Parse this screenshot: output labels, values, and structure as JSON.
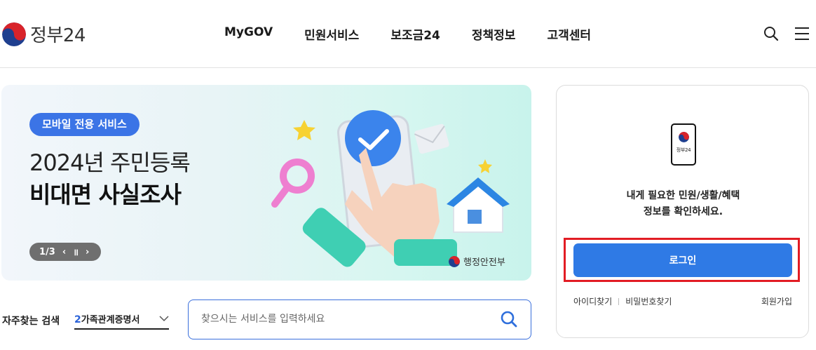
{
  "header": {
    "logo_text": "정부24",
    "nav": [
      "MyGOV",
      "민원서비스",
      "보조금24",
      "정책정보",
      "고객센터"
    ],
    "icons": [
      "search-icon",
      "menu-icon"
    ]
  },
  "banner": {
    "badge": "모바일 전용 서비스",
    "title": "2024년 주민등록",
    "subtitle": "비대면 사실조사",
    "pager_count": "1/3",
    "pager_prev": "‹",
    "pager_pause": "॥",
    "pager_next": "›",
    "ministry": "행정안전부"
  },
  "frequent": {
    "label": "자주찾는 검색",
    "rank": "2",
    "value": "가족관계증명서"
  },
  "search": {
    "placeholder": "찾으시는 서비스를 입력하세요"
  },
  "login": {
    "phone_label": "정부24",
    "message_line1": "내게 필요한 민원/생활/혜택",
    "message_line2": "정보를 확인하세요.",
    "button": "로그인",
    "find_id": "아이디찾기",
    "find_pw": "비밀번호찾기",
    "signup": "회원가입"
  },
  "colors": {
    "accent": "#3b74e6",
    "login_button": "#2f7ae5",
    "highlight": "#e21c24"
  }
}
